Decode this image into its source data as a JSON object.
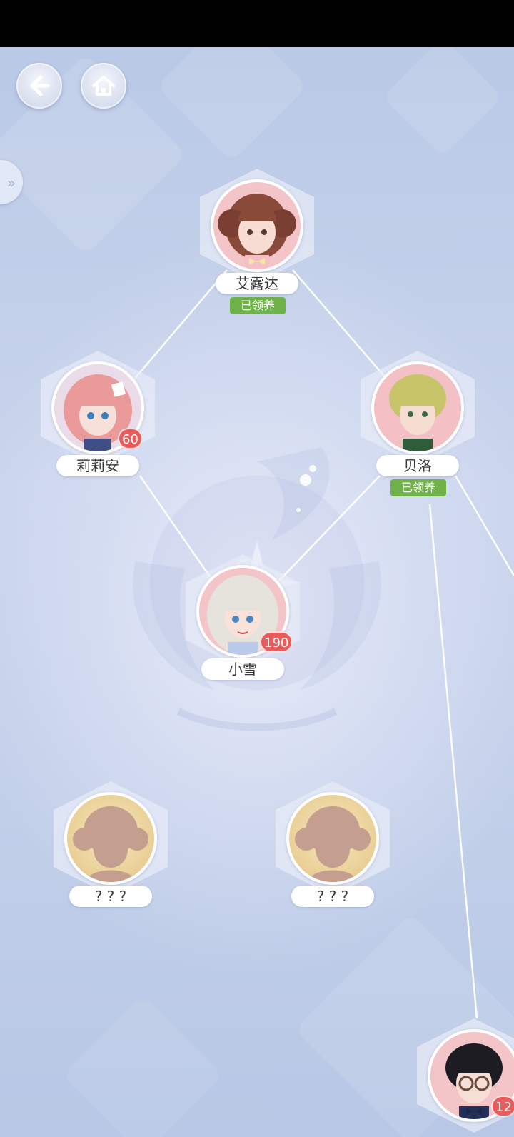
{
  "nav": {
    "back_icon": "arrow-left-icon",
    "home_icon": "home-icon",
    "side_tab_icon": "double-chevron-right-icon"
  },
  "nodes": {
    "ailuda": {
      "name": "艾露达",
      "status": "已领养"
    },
    "lilian": {
      "name": "莉莉安",
      "level": "60"
    },
    "beiluo": {
      "name": "贝洛",
      "status": "已领养"
    },
    "xiaoxue": {
      "name": "小雪",
      "level": "190"
    },
    "unknown1": {
      "name": "? ? ?"
    },
    "unknown2": {
      "name": "? ? ?"
    },
    "partial": {
      "level": "12"
    }
  },
  "colors": {
    "adopted_badge": "#6fb24a",
    "level_badge": "#ea5b5b",
    "link_line": "#ffffff"
  }
}
